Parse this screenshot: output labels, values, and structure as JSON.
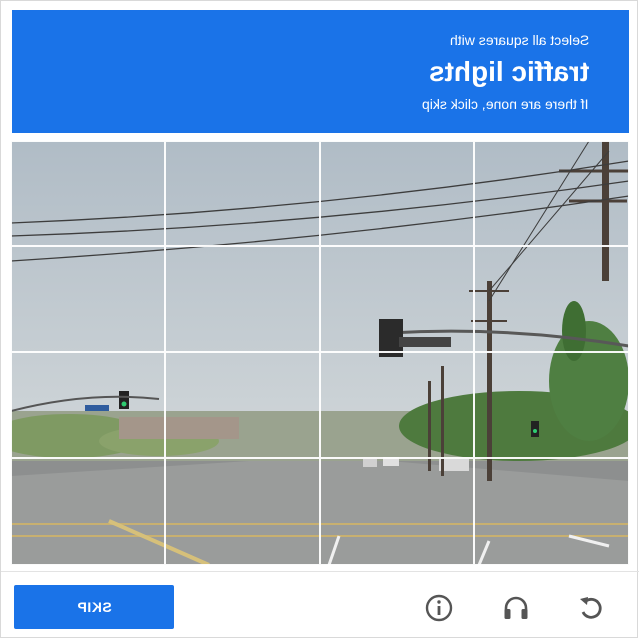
{
  "header": {
    "instruction": "Select all squares with",
    "target": "traffic lights",
    "sub_instruction": "If there are none, click skip"
  },
  "grid": {
    "rows": 4,
    "cols": 4,
    "tiles": [
      {
        "id": "r1c1"
      },
      {
        "id": "r1c2"
      },
      {
        "id": "r1c3"
      },
      {
        "id": "r1c4"
      },
      {
        "id": "r2c1"
      },
      {
        "id": "r2c2"
      },
      {
        "id": "r2c3"
      },
      {
        "id": "r2c4"
      },
      {
        "id": "r3c1"
      },
      {
        "id": "r3c2"
      },
      {
        "id": "r3c3"
      },
      {
        "id": "r3c4"
      },
      {
        "id": "r4c1"
      },
      {
        "id": "r4c2"
      },
      {
        "id": "r4c3"
      },
      {
        "id": "r4c4"
      }
    ]
  },
  "footer": {
    "skip_label": "SKIP",
    "icons": [
      "info-icon",
      "headphones-icon",
      "reload-icon"
    ]
  },
  "colors": {
    "accent": "#1a73e8",
    "icon": "#555555"
  }
}
